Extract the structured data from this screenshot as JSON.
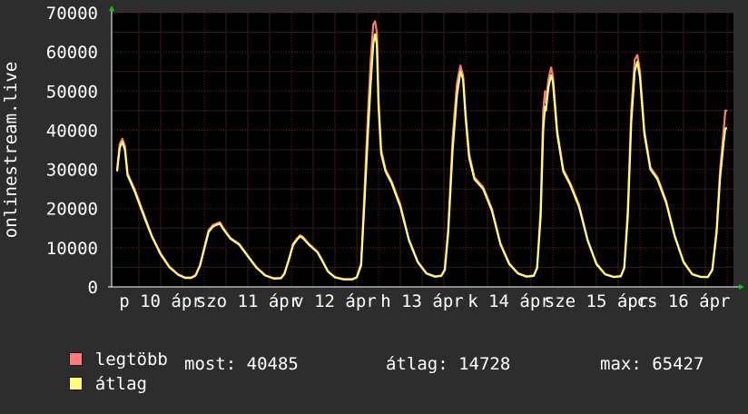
{
  "chart_data": {
    "type": "line",
    "ylabel": "onlinestream.live",
    "ylim": [
      0,
      70000
    ],
    "y_ticks": [
      0,
      10000,
      20000,
      30000,
      40000,
      50000,
      60000,
      70000
    ],
    "y_tick_labels": [
      "0",
      "10000",
      "20000",
      "30000",
      "40000",
      "50000",
      "60000",
      "70000"
    ],
    "x_tick_labels": [
      "p 10 ápr",
      "szo 11 ápr",
      "v 12 ápr",
      "h 13 ápr",
      "k 14 ápr",
      "sze 15 ápr",
      "cs 16 ápr"
    ],
    "x_range_days": [
      0,
      7.05
    ],
    "grid": true,
    "series": [
      {
        "name": "legtöbb",
        "color": "#ff7b7b",
        "points": [
          [
            0,
            30000
          ],
          [
            0.03,
            36500
          ],
          [
            0.06,
            37800
          ],
          [
            0.09,
            36000
          ],
          [
            0.12,
            29000
          ],
          [
            0.2,
            25000
          ],
          [
            0.3,
            19000
          ],
          [
            0.4,
            13000
          ],
          [
            0.5,
            8500
          ],
          [
            0.6,
            5200
          ],
          [
            0.7,
            3200
          ],
          [
            0.78,
            2400
          ],
          [
            0.85,
            2400
          ],
          [
            0.9,
            3000
          ],
          [
            0.95,
            5500
          ],
          [
            1.0,
            10000
          ],
          [
            1.05,
            14500
          ],
          [
            1.1,
            15800
          ],
          [
            1.15,
            16300
          ],
          [
            1.18,
            16500
          ],
          [
            1.22,
            15000
          ],
          [
            1.3,
            12500
          ],
          [
            1.4,
            11000
          ],
          [
            1.5,
            8000
          ],
          [
            1.6,
            5000
          ],
          [
            1.7,
            3000
          ],
          [
            1.8,
            2200
          ],
          [
            1.88,
            2300
          ],
          [
            1.92,
            3500
          ],
          [
            1.97,
            7000
          ],
          [
            2.02,
            11000
          ],
          [
            2.07,
            12500
          ],
          [
            2.1,
            13200
          ],
          [
            2.13,
            12800
          ],
          [
            2.2,
            11000
          ],
          [
            2.3,
            9000
          ],
          [
            2.35,
            7000
          ],
          [
            2.42,
            4000
          ],
          [
            2.5,
            2500
          ],
          [
            2.6,
            2000
          ],
          [
            2.7,
            2000
          ],
          [
            2.75,
            2500
          ],
          [
            2.8,
            6000
          ],
          [
            2.84,
            25000
          ],
          [
            2.88,
            45000
          ],
          [
            2.91,
            58000
          ],
          [
            2.94,
            67000
          ],
          [
            2.96,
            67800
          ],
          [
            2.98,
            65000
          ],
          [
            3.0,
            48000
          ],
          [
            3.03,
            35000
          ],
          [
            3.08,
            30000
          ],
          [
            3.15,
            27000
          ],
          [
            3.25,
            21000
          ],
          [
            3.35,
            12000
          ],
          [
            3.45,
            6500
          ],
          [
            3.55,
            3500
          ],
          [
            3.65,
            2700
          ],
          [
            3.72,
            2900
          ],
          [
            3.76,
            4500
          ],
          [
            3.8,
            15000
          ],
          [
            3.85,
            38000
          ],
          [
            3.9,
            52000
          ],
          [
            3.94,
            56500
          ],
          [
            3.97,
            54000
          ],
          [
            4.0,
            44000
          ],
          [
            4.04,
            34000
          ],
          [
            4.1,
            28000
          ],
          [
            4.2,
            25500
          ],
          [
            4.3,
            20000
          ],
          [
            4.4,
            11000
          ],
          [
            4.5,
            6000
          ],
          [
            4.6,
            3500
          ],
          [
            4.7,
            2700
          ],
          [
            4.78,
            2900
          ],
          [
            4.82,
            5000
          ],
          [
            4.86,
            20000
          ],
          [
            4.89,
            45000
          ],
          [
            4.91,
            50000
          ],
          [
            4.92,
            47000
          ],
          [
            4.95,
            53000
          ],
          [
            4.98,
            56000
          ],
          [
            5.0,
            54000
          ],
          [
            5.05,
            40000
          ],
          [
            5.12,
            30000
          ],
          [
            5.2,
            26500
          ],
          [
            5.3,
            21000
          ],
          [
            5.4,
            12000
          ],
          [
            5.5,
            6000
          ],
          [
            5.6,
            3300
          ],
          [
            5.7,
            2600
          ],
          [
            5.78,
            2800
          ],
          [
            5.82,
            5000
          ],
          [
            5.86,
            20000
          ],
          [
            5.9,
            45000
          ],
          [
            5.94,
            58000
          ],
          [
            5.97,
            59200
          ],
          [
            6.0,
            55000
          ],
          [
            6.05,
            40000
          ],
          [
            6.12,
            30500
          ],
          [
            6.2,
            28000
          ],
          [
            6.3,
            22000
          ],
          [
            6.4,
            13000
          ],
          [
            6.5,
            6500
          ],
          [
            6.6,
            3300
          ],
          [
            6.7,
            2600
          ],
          [
            6.78,
            2600
          ],
          [
            6.83,
            4500
          ],
          [
            6.88,
            15000
          ],
          [
            6.92,
            30000
          ],
          [
            6.96,
            40000
          ],
          [
            6.98,
            45000
          ],
          [
            7.0,
            45000
          ]
        ]
      },
      {
        "name": "átlag",
        "color": "#ffff7b",
        "points": [
          [
            0,
            29500
          ],
          [
            0.03,
            35500
          ],
          [
            0.06,
            37000
          ],
          [
            0.09,
            35000
          ],
          [
            0.12,
            28500
          ],
          [
            0.2,
            24500
          ],
          [
            0.3,
            18500
          ],
          [
            0.4,
            12800
          ],
          [
            0.5,
            8300
          ],
          [
            0.6,
            5000
          ],
          [
            0.7,
            3100
          ],
          [
            0.78,
            2300
          ],
          [
            0.85,
            2300
          ],
          [
            0.9,
            2900
          ],
          [
            0.95,
            5300
          ],
          [
            1.0,
            9700
          ],
          [
            1.05,
            14000
          ],
          [
            1.1,
            15400
          ],
          [
            1.15,
            15900
          ],
          [
            1.18,
            16100
          ],
          [
            1.22,
            14700
          ],
          [
            1.3,
            12300
          ],
          [
            1.4,
            10800
          ],
          [
            1.5,
            7800
          ],
          [
            1.6,
            4900
          ],
          [
            1.7,
            2900
          ],
          [
            1.8,
            2100
          ],
          [
            1.88,
            2200
          ],
          [
            1.92,
            3300
          ],
          [
            1.97,
            6800
          ],
          [
            2.02,
            10700
          ],
          [
            2.07,
            12200
          ],
          [
            2.1,
            12900
          ],
          [
            2.13,
            12500
          ],
          [
            2.2,
            10800
          ],
          [
            2.3,
            8800
          ],
          [
            2.35,
            6800
          ],
          [
            2.42,
            3900
          ],
          [
            2.5,
            2400
          ],
          [
            2.6,
            1900
          ],
          [
            2.7,
            1900
          ],
          [
            2.75,
            2400
          ],
          [
            2.8,
            5500
          ],
          [
            2.84,
            22000
          ],
          [
            2.88,
            40000
          ],
          [
            2.91,
            52000
          ],
          [
            2.94,
            62000
          ],
          [
            2.96,
            64500
          ],
          [
            2.98,
            62000
          ],
          [
            3.0,
            46000
          ],
          [
            3.03,
            34000
          ],
          [
            3.08,
            29500
          ],
          [
            3.15,
            26500
          ],
          [
            3.25,
            20500
          ],
          [
            3.35,
            11800
          ],
          [
            3.45,
            6300
          ],
          [
            3.55,
            3400
          ],
          [
            3.65,
            2600
          ],
          [
            3.72,
            2800
          ],
          [
            3.76,
            4300
          ],
          [
            3.8,
            14000
          ],
          [
            3.85,
            35000
          ],
          [
            3.9,
            49000
          ],
          [
            3.94,
            55000
          ],
          [
            3.97,
            53000
          ],
          [
            4.0,
            43000
          ],
          [
            4.04,
            33000
          ],
          [
            4.1,
            27500
          ],
          [
            4.2,
            25000
          ],
          [
            4.3,
            19500
          ],
          [
            4.4,
            10800
          ],
          [
            4.5,
            5800
          ],
          [
            4.6,
            3400
          ],
          [
            4.7,
            2600
          ],
          [
            4.78,
            2800
          ],
          [
            4.82,
            4800
          ],
          [
            4.86,
            18000
          ],
          [
            4.89,
            40000
          ],
          [
            4.91,
            46000
          ],
          [
            4.92,
            45000
          ],
          [
            4.95,
            51000
          ],
          [
            4.98,
            54000
          ],
          [
            5.0,
            52500
          ],
          [
            5.05,
            39000
          ],
          [
            5.12,
            29500
          ],
          [
            5.2,
            26000
          ],
          [
            5.3,
            20500
          ],
          [
            5.4,
            11800
          ],
          [
            5.5,
            5800
          ],
          [
            5.6,
            3200
          ],
          [
            5.7,
            2500
          ],
          [
            5.78,
            2700
          ],
          [
            5.82,
            4800
          ],
          [
            5.86,
            18000
          ],
          [
            5.9,
            42000
          ],
          [
            5.94,
            55000
          ],
          [
            5.97,
            57500
          ],
          [
            6.0,
            53500
          ],
          [
            6.05,
            39000
          ],
          [
            6.12,
            30000
          ],
          [
            6.2,
            27500
          ],
          [
            6.3,
            21500
          ],
          [
            6.4,
            12800
          ],
          [
            6.5,
            6300
          ],
          [
            6.6,
            3200
          ],
          [
            6.7,
            2500
          ],
          [
            6.78,
            2500
          ],
          [
            6.83,
            4300
          ],
          [
            6.88,
            14000
          ],
          [
            6.92,
            28000
          ],
          [
            6.96,
            37000
          ],
          [
            6.98,
            40485
          ],
          [
            7.0,
            40485
          ]
        ]
      }
    ]
  },
  "legend": [
    {
      "label": "legtöbb",
      "color": "#ff7b7b"
    },
    {
      "label": "átlag",
      "color": "#ffff7b"
    }
  ],
  "stats": {
    "most": "most: 40485",
    "atlag": "átlag: 14728",
    "max": "max: 65427"
  }
}
